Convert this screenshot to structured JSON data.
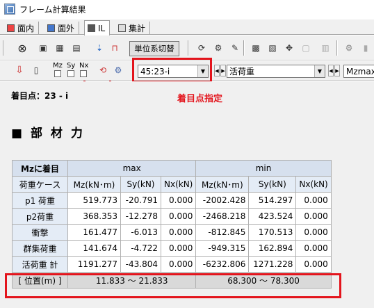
{
  "window": {
    "title": "フレーム計算結果"
  },
  "tabs": [
    {
      "label": "面内",
      "active": false
    },
    {
      "label": "面外",
      "active": false
    },
    {
      "label": "IL",
      "active": true
    },
    {
      "label": "集計",
      "active": false
    }
  ],
  "toolbar": {
    "unit_button": "単位系切替",
    "checkbox_labels": {
      "mz": "Mz",
      "sy": "Sy",
      "nx": "Nx"
    },
    "point_select": {
      "value": "45:23-i"
    },
    "case_select": {
      "value": "活荷重"
    },
    "result_select": {
      "value": "Mzmax"
    }
  },
  "focus": {
    "label": "着目点：23 - i",
    "annotation": "着目点指定"
  },
  "section": {
    "title": "■ 部 材 力"
  },
  "table": {
    "corner": "Mzに着目",
    "group_max": "max",
    "group_min": "min",
    "case_header": "荷重ケース",
    "col_headers": [
      "Mz(kN･m)",
      "Sy(kN)",
      "Nx(kN)",
      "Mz(kN･m)",
      "Sy(kN)",
      "Nx(kN)"
    ],
    "rows": [
      {
        "name": "p1 荷重",
        "values": [
          "519.773",
          "-20.791",
          "0.000",
          "-2002.428",
          "514.297",
          "0.000"
        ]
      },
      {
        "name": "p2荷重",
        "values": [
          "368.353",
          "-12.278",
          "0.000",
          "-2468.218",
          "423.524",
          "0.000"
        ]
      },
      {
        "name": "衝撃",
        "values": [
          "161.477",
          "-6.013",
          "0.000",
          "-812.845",
          "170.513",
          "0.000"
        ]
      },
      {
        "name": "群集荷重",
        "values": [
          "141.674",
          "-4.722",
          "0.000",
          "-949.315",
          "162.894",
          "0.000"
        ]
      },
      {
        "name": "活荷重 計",
        "values": [
          "1191.277",
          "-43.804",
          "0.000",
          "-6232.806",
          "1271.228",
          "0.000"
        ]
      }
    ],
    "position_label": "[ 位置(m) ]",
    "position_max": "11.833 〜 21.833",
    "position_min": "68.300 〜 78.300"
  },
  "colors": {
    "highlight": "#e3141c",
    "header_bg": "#d6e0ee"
  }
}
